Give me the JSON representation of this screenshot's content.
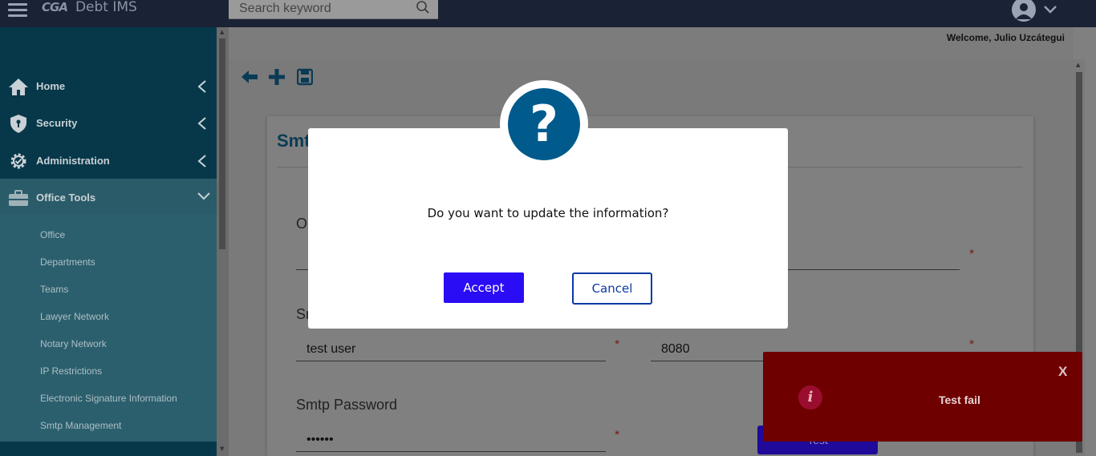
{
  "header": {
    "logo_mark": "CGA",
    "app_name": "Debt IMS",
    "search_placeholder": "Search keyword",
    "icons": {
      "menu": "hamburger-icon",
      "search": "search-icon",
      "user": "user-avatar-icon",
      "dropdown": "chevron-down-icon"
    }
  },
  "welcome": "Welcome, Julio Uzcátegui",
  "sidebar": {
    "items": [
      {
        "label": "Home",
        "icon": "home-icon"
      },
      {
        "label": "Security",
        "icon": "shield-icon"
      },
      {
        "label": "Administration",
        "icon": "gear-icon"
      },
      {
        "label": "Office Tools",
        "icon": "briefcase-icon",
        "expanded": true
      }
    ],
    "submenu": [
      "Office",
      "Departments",
      "Teams",
      "Lawyer Network",
      "Notary Network",
      "IP Restrictions",
      "Electronic Signature Information",
      "Smtp Management"
    ]
  },
  "toolbar": {
    "icons": [
      "back-arrow-icon",
      "plus-icon",
      "save-icon"
    ]
  },
  "card": {
    "title_visible": "Smt",
    "label_1_visible": "O",
    "label_2_visible": "Sm",
    "field_user_value": "test user",
    "field_port_value": "8080",
    "password_label": "Smtp Password",
    "password_value": "••••••",
    "test_button_label": "Test",
    "required_mark": "*"
  },
  "modal": {
    "icon": "question-icon",
    "icon_glyph": "?",
    "message": "Do you want to update the information?",
    "accept_label": "Accept",
    "cancel_label": "Cancel"
  },
  "toast": {
    "close_label": "X",
    "icon": "info-icon",
    "icon_glyph": "i",
    "message": "Test fail",
    "color": "#6f0000"
  },
  "colors": {
    "accent": "#2a0cf5",
    "sidebar": "#07384a",
    "modal_icon": "#005b8c"
  }
}
